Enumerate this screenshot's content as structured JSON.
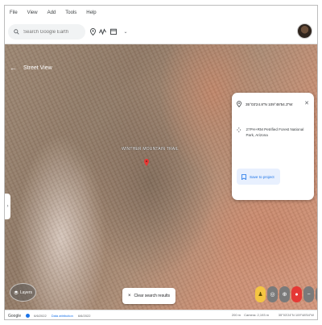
{
  "menu": {
    "items": [
      "File",
      "View",
      "Add",
      "Tools",
      "Help"
    ]
  },
  "search": {
    "placeholder": "Search Google Earth"
  },
  "map": {
    "mode_label": "Street View",
    "place_label": "WINTHER MOUNTAIN TRAIL",
    "layers_label": "Layers",
    "clear_results_label": "Clear search results"
  },
  "card": {
    "coordinates": "35°03'24.8\"N 109°48'54.3\"W",
    "address": "27PH+RM Petrified Forest National Park, Arizona",
    "save_label": "Save to project"
  },
  "statusbar": {
    "google": "Google",
    "date": "6/6/2022",
    "data_attribution": "Data attribution",
    "segment": "6/6/2022",
    "scale": "200 m",
    "camera": "Camera: 2,193 m",
    "coordinates": "35°03'24\"N 109°48'54\"W"
  },
  "colors": {
    "accent": "#1a73e8",
    "pin": "#e53935"
  }
}
